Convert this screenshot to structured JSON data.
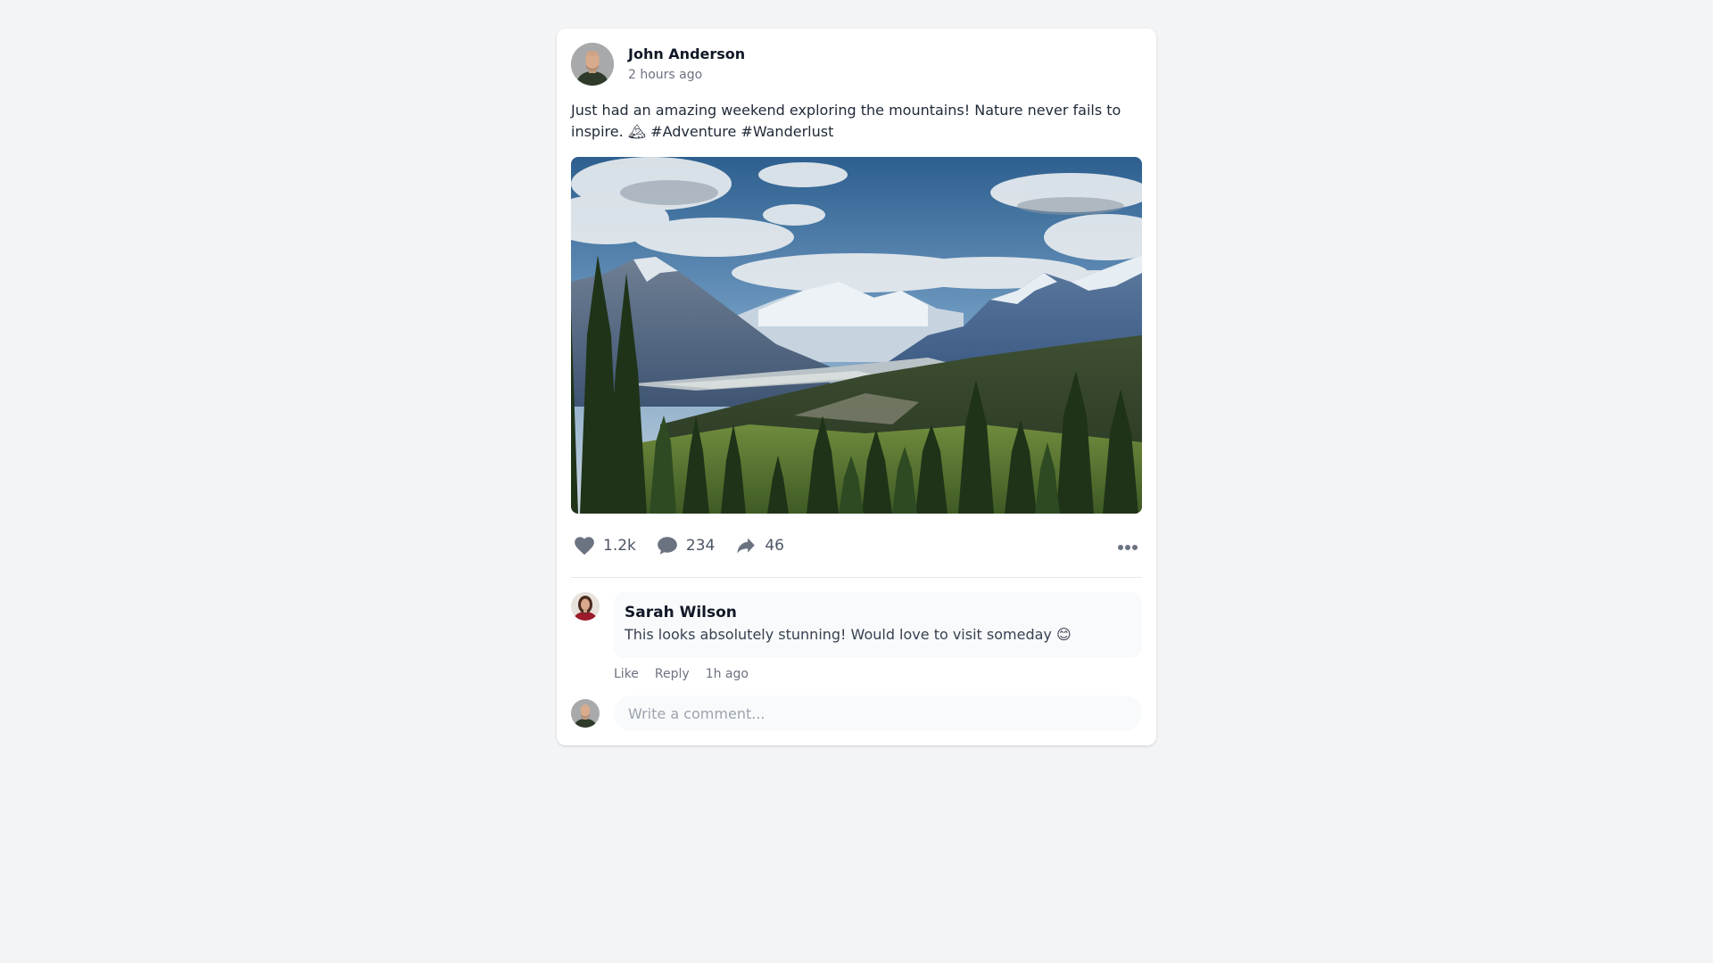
{
  "post": {
    "author_name": "John Anderson",
    "time": "2 hours ago",
    "text": "Just had an amazing weekend exploring the mountains! Nature never fails to inspire. 🏔 #Adventure #Wanderlust",
    "image_icon": "mountain-landscape-photo",
    "likes": "1.2k",
    "comments": "234",
    "shares": "46"
  },
  "comment": {
    "author_name": "Sarah Wilson",
    "text": "This looks absolutely stunning! Would love to visit someday 😊",
    "like_label": "Like",
    "reply_label": "Reply",
    "time": "1h ago"
  },
  "new_comment": {
    "placeholder": "Write a comment..."
  },
  "colors": {
    "background": "#f3f4f6",
    "card": "#ffffff",
    "muted_text": "#6b7280",
    "icon": "#6b7280"
  }
}
